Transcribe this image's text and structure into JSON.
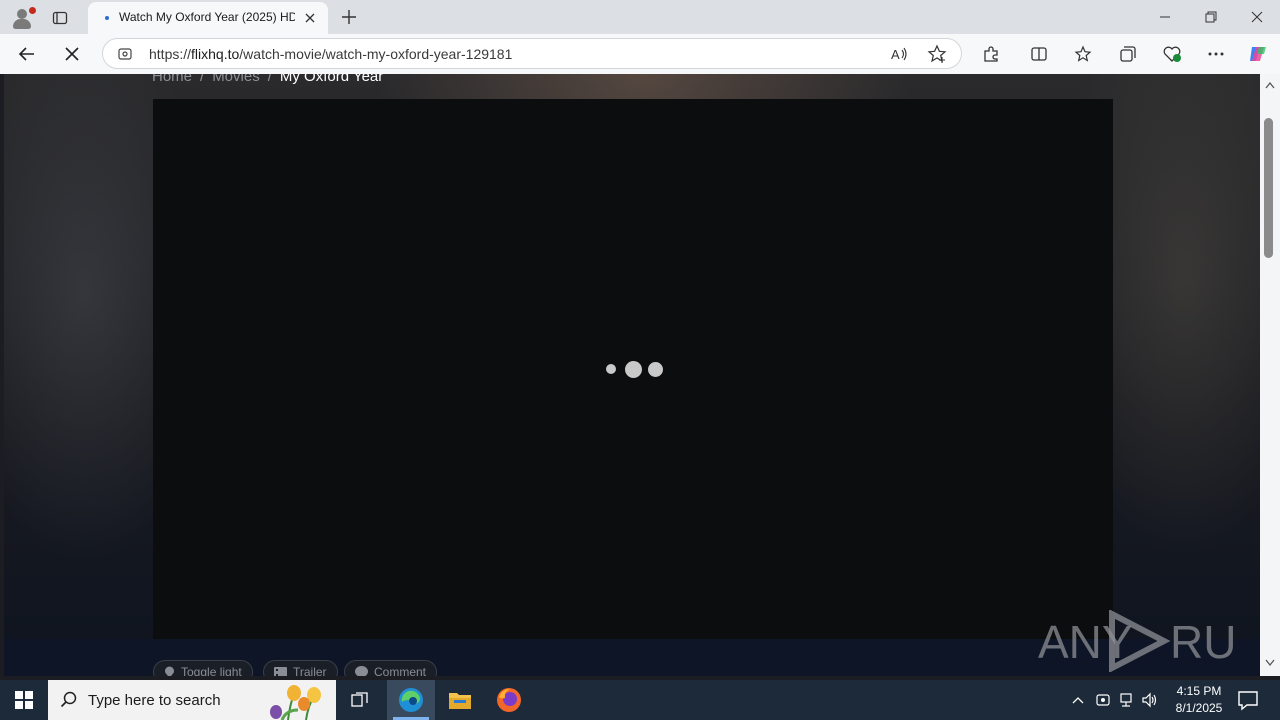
{
  "tab": {
    "title": "Watch My Oxford Year (2025) HD"
  },
  "address_bar": {
    "url_prefix": "https://",
    "url_host": "flixhq.to",
    "url_path": "/watch-movie/watch-my-oxford-year-129181"
  },
  "breadcrumb": {
    "items": [
      "Home",
      "Movies"
    ],
    "separator": "/",
    "current": "My Oxford Year"
  },
  "player_actions": [
    {
      "label": "Toggle light",
      "icon": "lightbulb-icon"
    },
    {
      "label": "Trailer",
      "icon": "film-icon"
    },
    {
      "label": "Comment",
      "icon": "comment-icon"
    }
  ],
  "watermark": {
    "text_left": "ANY",
    "text_right": "RUN"
  },
  "taskbar": {
    "search_placeholder": "Type here to search",
    "time": "4:15 PM",
    "date": "8/1/2025"
  },
  "colors": {
    "accent": "#0078d4",
    "page_background": "#1a1b20",
    "player_background": "#0c0d0f"
  }
}
